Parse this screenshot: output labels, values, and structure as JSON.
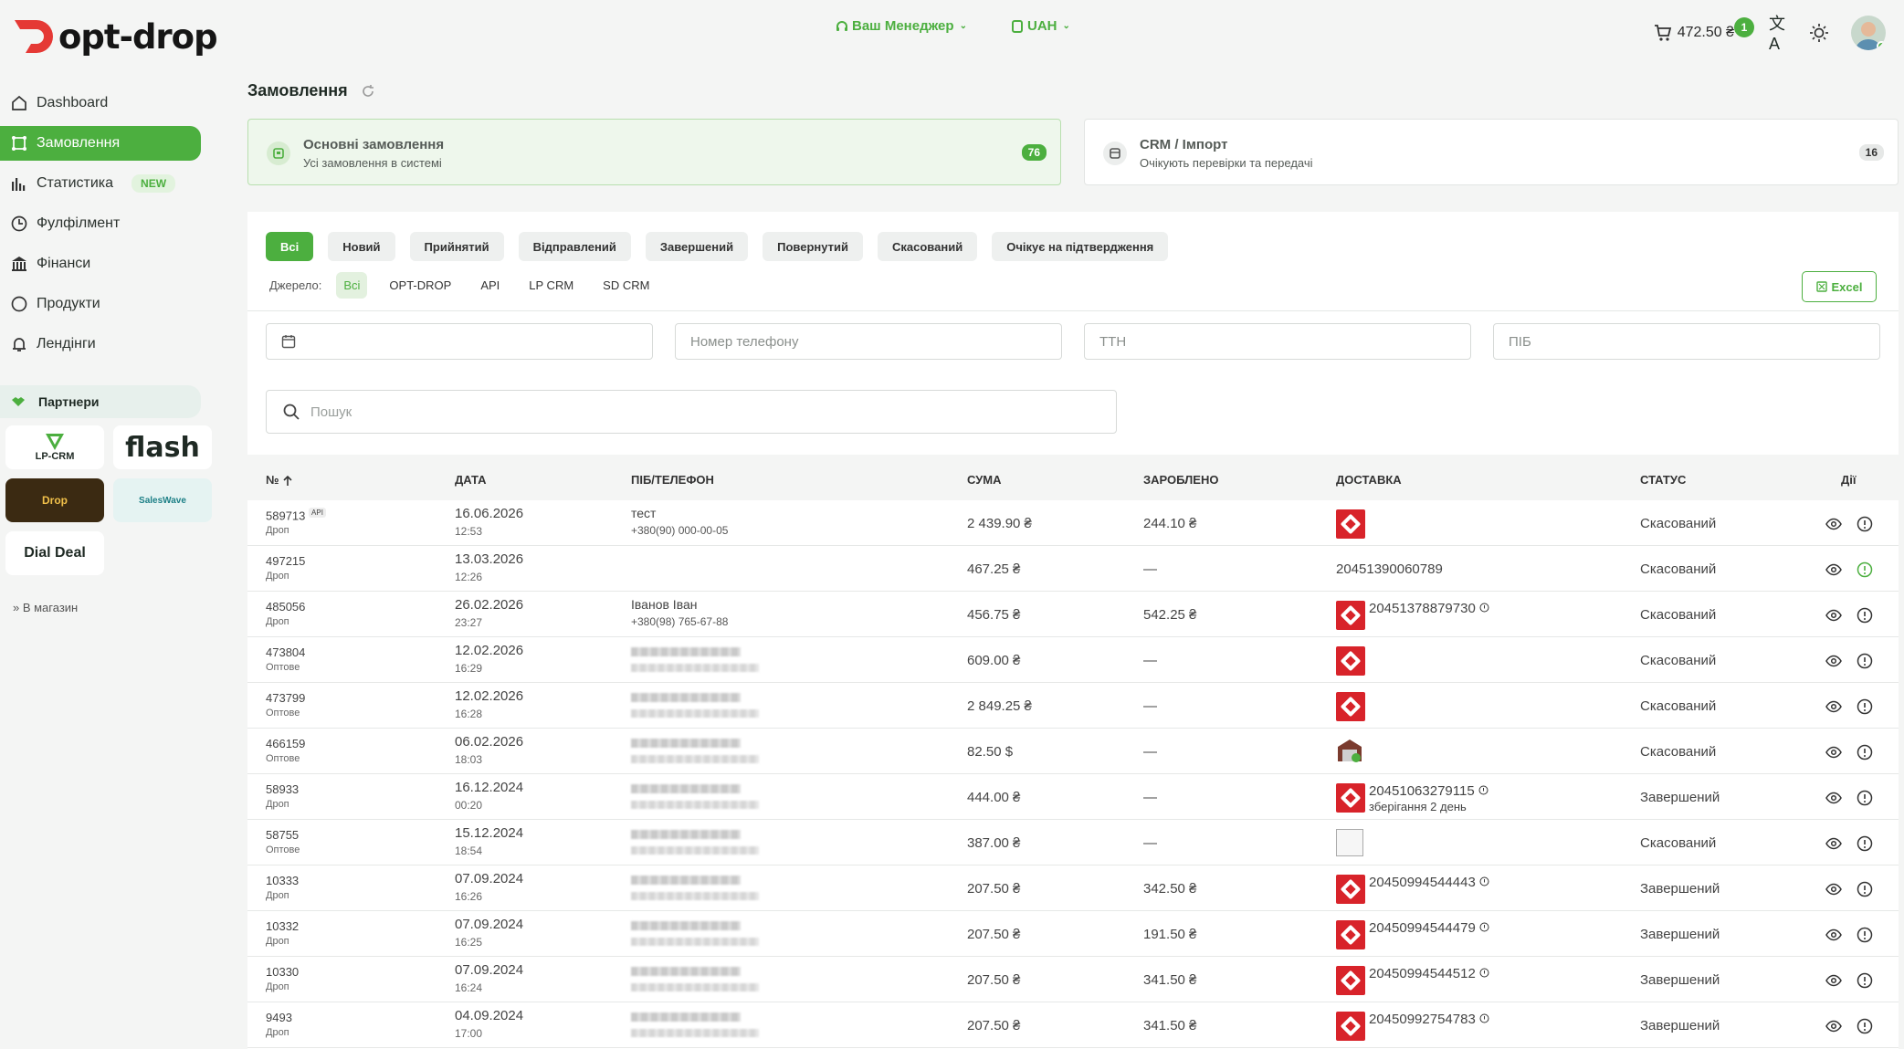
{
  "header": {
    "logo_text": "opt-drop",
    "manager_label": "Ваш Менеджер",
    "currency_label": "UAH",
    "cart_amount": "472.50 ₴",
    "cart_badge": "1",
    "brand_color": "#4caf3f"
  },
  "sidebar": {
    "items": [
      {
        "label": "Dashboard",
        "icon": "home-icon"
      },
      {
        "label": "Замовлення",
        "icon": "orders-icon"
      },
      {
        "label": "Статистика",
        "icon": "bar-chart-icon",
        "badge": "NEW"
      },
      {
        "label": "Фулфілмент",
        "icon": "clock-icon"
      },
      {
        "label": "Фінанси",
        "icon": "bank-icon"
      },
      {
        "label": "Продукти",
        "icon": "circle-icon"
      },
      {
        "label": "Лендінги",
        "icon": "bell-icon"
      }
    ],
    "partners_label": "Партнери",
    "partners": [
      "LP-CRM",
      "flash",
      "Drop",
      "SalesWave",
      "Dial Deal"
    ],
    "to_store": "» В магазин"
  },
  "page": {
    "title": "Замовлення"
  },
  "cards": {
    "main": {
      "title": "Основні замовлення",
      "subtitle": "Усі замовлення в системі",
      "count": "76"
    },
    "crm": {
      "title": "CRM / Імпорт",
      "subtitle": "Очікують перевірки та передачі",
      "count": "16"
    }
  },
  "tabs": [
    "Всі",
    "Новий",
    "Прийнятий",
    "Відправлений",
    "Завершений",
    "Повернутий",
    "Скасований",
    "Очікує на підтвердження"
  ],
  "sources": {
    "label": "Джерело:",
    "items": [
      "Всі",
      "OPT-DROP",
      "API",
      "LP CRM",
      "SD CRM"
    ]
  },
  "excel_label": "Excel",
  "filters": {
    "phone_placeholder": "Номер телефону",
    "ttn_placeholder": "ТТН",
    "name_placeholder": "ПІБ",
    "search_placeholder": "Пошук"
  },
  "table": {
    "headers": {
      "num": "№",
      "date": "ДАТА",
      "name": "ПІБ/ТЕЛЕФОН",
      "sum": "СУМА",
      "earned": "ЗАРОБЛЕНО",
      "delivery": "ДОСТАВКА",
      "status": "СТАТУС",
      "actions": "Дії"
    },
    "rows": [
      {
        "num": "589713",
        "api": "API",
        "type": "Дроп",
        "date": "16.06.2026",
        "time": "12:53",
        "name": "тест",
        "phone": "+380(90) 000-00-05",
        "sum": "2 439.90 ₴",
        "earned": "244.10 ₴",
        "delivery": "np",
        "ttn": "",
        "ttn_sub": "",
        "status": "Скасований"
      },
      {
        "num": "497215",
        "type": "Дроп",
        "date": "13.03.2026",
        "time": "12:26",
        "name": "",
        "phone": "",
        "sum": "467.25 ₴",
        "earned": "—",
        "delivery": "text",
        "ttn": "20451390060789",
        "ttn_sub": "",
        "status": "Скасований"
      },
      {
        "num": "485056",
        "type": "Дроп",
        "date": "26.02.2026",
        "time": "23:27",
        "name": "Іванов Іван",
        "phone": "+380(98) 765-67-88",
        "sum": "456.75 ₴",
        "earned": "542.25 ₴",
        "delivery": "np",
        "ttn": "20451378879730",
        "ttn_sub": "",
        "status": "Скасований"
      },
      {
        "num": "473804",
        "type": "Оптове",
        "date": "12.02.2026",
        "time": "16:29",
        "name": "blur",
        "sum": "609.00 ₴",
        "earned": "—",
        "delivery": "np",
        "ttn": "",
        "ttn_sub": "",
        "status": "Скасований"
      },
      {
        "num": "473799",
        "type": "Оптове",
        "date": "12.02.2026",
        "time": "16:28",
        "name": "blur",
        "sum": "2 849.25 ₴",
        "earned": "—",
        "delivery": "np",
        "ttn": "",
        "ttn_sub": "",
        "status": "Скасований"
      },
      {
        "num": "466159",
        "type": "Оптове",
        "date": "06.02.2026",
        "time": "18:03",
        "name": "blur",
        "sum": "82.50 $",
        "earned": "—",
        "delivery": "warehouse",
        "ttn": "",
        "ttn_sub": "",
        "status": "Скасований"
      },
      {
        "num": "58933",
        "type": "Дроп",
        "date": "16.12.2024",
        "time": "00:20",
        "name": "blur",
        "sum": "444.00 ₴",
        "earned": "—",
        "delivery": "np",
        "ttn": "20451063279115",
        "ttn_sub": "зберігання 2 день",
        "status": "Завершений"
      },
      {
        "num": "58755",
        "type": "Оптове",
        "date": "15.12.2024",
        "time": "18:54",
        "name": "blur",
        "sum": "387.00 ₴",
        "earned": "—",
        "delivery": "broken",
        "ttn": "",
        "ttn_sub": "",
        "status": "Скасований"
      },
      {
        "num": "10333",
        "type": "Дроп",
        "date": "07.09.2024",
        "time": "16:26",
        "name": "blur",
        "sum": "207.50 ₴",
        "earned": "342.50 ₴",
        "delivery": "np",
        "ttn": "20450994544443",
        "ttn_sub": "",
        "status": "Завершений"
      },
      {
        "num": "10332",
        "type": "Дроп",
        "date": "07.09.2024",
        "time": "16:25",
        "name": "blur",
        "sum": "207.50 ₴",
        "earned": "191.50 ₴",
        "delivery": "np",
        "ttn": "20450994544479",
        "ttn_sub": "",
        "status": "Завершений"
      },
      {
        "num": "10330",
        "type": "Дроп",
        "date": "07.09.2024",
        "time": "16:24",
        "name": "blur",
        "sum": "207.50 ₴",
        "earned": "341.50 ₴",
        "delivery": "np",
        "ttn": "20450994544512",
        "ttn_sub": "",
        "status": "Завершений"
      },
      {
        "num": "9493",
        "type": "Дроп",
        "date": "04.09.2024",
        "time": "17:00",
        "name": "blur",
        "sum": "207.50 ₴",
        "earned": "341.50 ₴",
        "delivery": "np",
        "ttn": "20450992754783",
        "ttn_sub": "",
        "status": "Завершений"
      }
    ]
  }
}
